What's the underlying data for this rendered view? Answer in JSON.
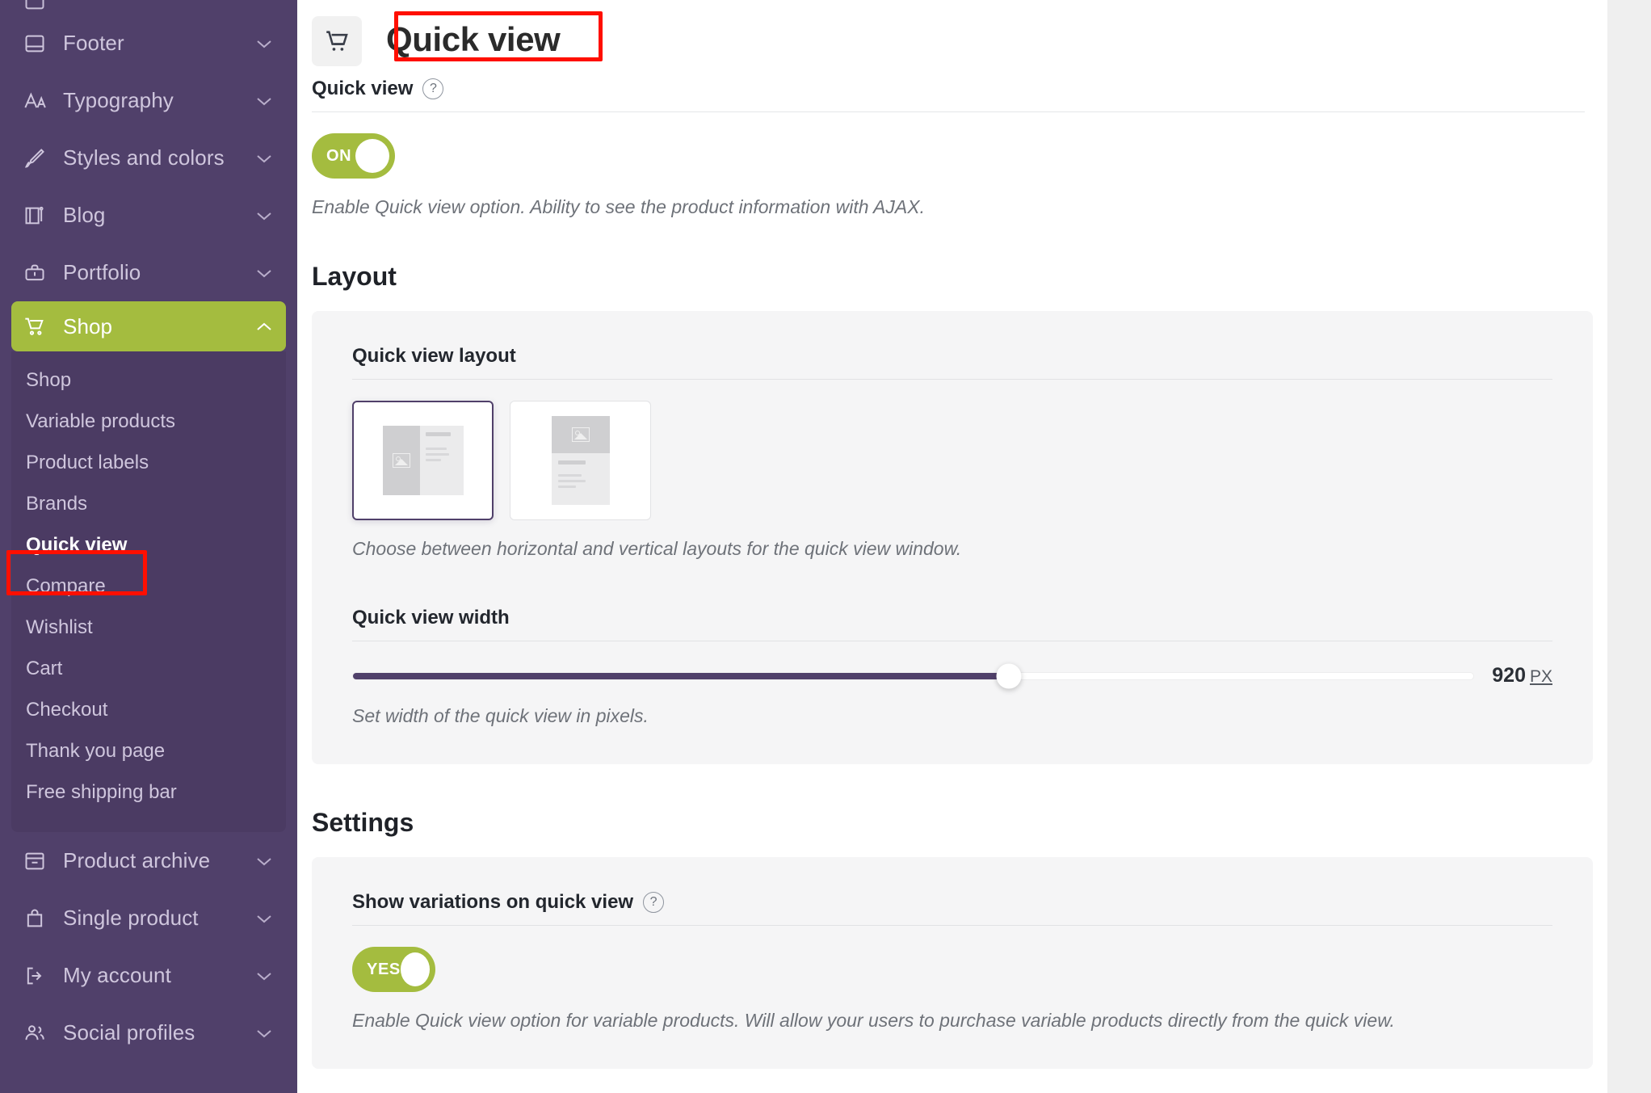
{
  "sidebar": {
    "partial_item_label": "",
    "items": [
      {
        "label": "Footer",
        "icon": "footer-icon",
        "expanded": false
      },
      {
        "label": "Typography",
        "icon": "typography-icon",
        "expanded": false
      },
      {
        "label": "Styles and colors",
        "icon": "brush-icon",
        "expanded": false
      },
      {
        "label": "Blog",
        "icon": "blog-icon",
        "expanded": false
      },
      {
        "label": "Portfolio",
        "icon": "briefcase-icon",
        "expanded": false
      },
      {
        "label": "Shop",
        "icon": "cart-icon",
        "expanded": true,
        "active": true
      },
      {
        "label": "Product archive",
        "icon": "archive-icon",
        "expanded": false
      },
      {
        "label": "Single product",
        "icon": "bag-icon",
        "expanded": false
      },
      {
        "label": "My account",
        "icon": "login-icon",
        "expanded": false
      },
      {
        "label": "Social profiles",
        "icon": "people-icon",
        "expanded": false
      }
    ],
    "shop_submenu": [
      "Shop",
      "Variable products",
      "Product labels",
      "Brands",
      "Quick view",
      "Compare",
      "Wishlist",
      "Cart",
      "Checkout",
      "Thank you page",
      "Free shipping bar"
    ],
    "current_submenu_item": "Quick view",
    "colors": {
      "background": "#50406a",
      "submenu_background": "#4b3b63",
      "active": "#a4bc3f",
      "text": "#cfc6dd"
    }
  },
  "header": {
    "icon": "cart-icon",
    "title": "Quick view"
  },
  "quick_view_field": {
    "label": "Quick view",
    "help": "?",
    "toggle_state": "ON",
    "description": "Enable Quick view option. Ability to see the product information with AJAX."
  },
  "layout_section": {
    "title": "Layout",
    "layout_field": {
      "label": "Quick view layout",
      "description": "Choose between horizontal and vertical layouts for the quick view window.",
      "options": [
        {
          "name": "horizontal",
          "selected": true
        },
        {
          "name": "vertical",
          "selected": false
        }
      ]
    },
    "width_field": {
      "label": "Quick view width",
      "value": "920",
      "unit": "PX",
      "percent_filled": 58.5,
      "description": "Set width of the quick view in pixels."
    }
  },
  "settings_section": {
    "title": "Settings",
    "variations_field": {
      "label": "Show variations on quick view",
      "help": "?",
      "toggle_state": "YES",
      "description": "Enable Quick view option for variable products. Will allow your users to purchase variable products directly from the quick view."
    }
  },
  "annotations": {
    "title_highlight": "Quick view",
    "sidebar_highlight": "Quick view",
    "color": "#ff0f00"
  }
}
